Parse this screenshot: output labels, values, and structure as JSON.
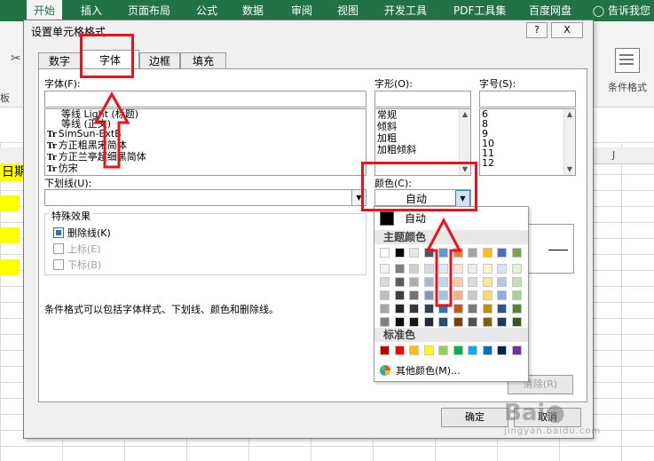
{
  "excel": {
    "ribbon_tabs": [
      "开始",
      "插入",
      "页面布局",
      "公式",
      "数据",
      "审阅",
      "视图",
      "开发工具",
      "PDF工具集",
      "百度网盘"
    ],
    "active_tab": "开始",
    "tell_me": "告诉我您",
    "cond_format_label": "条件格式",
    "left_group_label": "板",
    "column_j": "J",
    "date_cell": "日期"
  },
  "dialog": {
    "title": "设置单元格格式",
    "help_label": "?",
    "close_label": "X",
    "tabs": [
      "数字",
      "字体",
      "边框",
      "填充"
    ],
    "active_tab": "字体",
    "font": {
      "label": "字体(F):",
      "items": [
        "等线 Light (标题)",
        "等线 (正文)",
        "SimSun-ExtB",
        "方正粗黑宋简体",
        "方正兰亭超细黑简体",
        "仿宋"
      ],
      "item_icons": [
        "",
        "",
        "Tr",
        "Tr",
        "Tr",
        "Tr"
      ]
    },
    "style": {
      "label": "字形(O):",
      "items": [
        "常规",
        "倾斜",
        "加粗",
        "加粗倾斜"
      ]
    },
    "size": {
      "label": "字号(S):",
      "items": [
        "6",
        "8",
        "9",
        "10",
        "11",
        "12"
      ]
    },
    "underline": {
      "label": "下划线(U):"
    },
    "color": {
      "label": "颜色(C):",
      "value": "自动"
    },
    "effects": {
      "title": "特殊效果",
      "strikethrough": "删除线(K)",
      "superscript": "上标(E)",
      "subscript": "下标(B)"
    },
    "note": "条件格式可以包括字体样式、下划线、颜色和删除线。",
    "clear_button": "清除(R)",
    "ok_button": "确定",
    "cancel_button": "取消"
  },
  "palette": {
    "auto_label": "自动",
    "theme_title": "主题颜色",
    "standard_title": "标准色",
    "more_colors": "其他颜色(M)...",
    "theme_top": [
      "#ffffff",
      "#000000",
      "#e7e6e6",
      "#44546a",
      "#5b9bd5",
      "#ed7d31",
      "#a5a5a5",
      "#ffc000",
      "#4472c4",
      "#70ad47"
    ],
    "theme_shades": [
      [
        "#f2f2f2",
        "#d9d9d9",
        "#bfbfbf",
        "#a6a6a6",
        "#808080"
      ],
      [
        "#808080",
        "#595959",
        "#404040",
        "#262626",
        "#0d0d0d"
      ],
      [
        "#d0cece",
        "#aeabab",
        "#757171",
        "#3a3838",
        "#171616"
      ],
      [
        "#d6dce4",
        "#adb9ca",
        "#8497b0",
        "#333f4f",
        "#222a35"
      ],
      [
        "#deebf7",
        "#bdd7ee",
        "#9dc3e6",
        "#2e75b6",
        "#1f4e79"
      ],
      [
        "#fbe5d6",
        "#f8cbad",
        "#f4b183",
        "#c55a11",
        "#843c0c"
      ],
      [
        "#ededed",
        "#dbdbdb",
        "#c9c9c9",
        "#7b7b7b",
        "#525252"
      ],
      [
        "#fff2cc",
        "#ffe699",
        "#ffd966",
        "#bf9000",
        "#7f6000"
      ],
      [
        "#dae3f3",
        "#b4c7e7",
        "#8faadc",
        "#2f5597",
        "#203864"
      ],
      [
        "#e2f0d9",
        "#c5e0b4",
        "#a9d18e",
        "#538135",
        "#375623"
      ]
    ],
    "standard": [
      "#c00000",
      "#ff0000",
      "#ffc000",
      "#ffff00",
      "#92d050",
      "#00b050",
      "#00b0f0",
      "#0070c0",
      "#002060",
      "#7030a0"
    ]
  },
  "annotation_color": "#e8141b",
  "watermark": {
    "main": "Bai",
    "sub": "jingyan.baidu.com"
  }
}
